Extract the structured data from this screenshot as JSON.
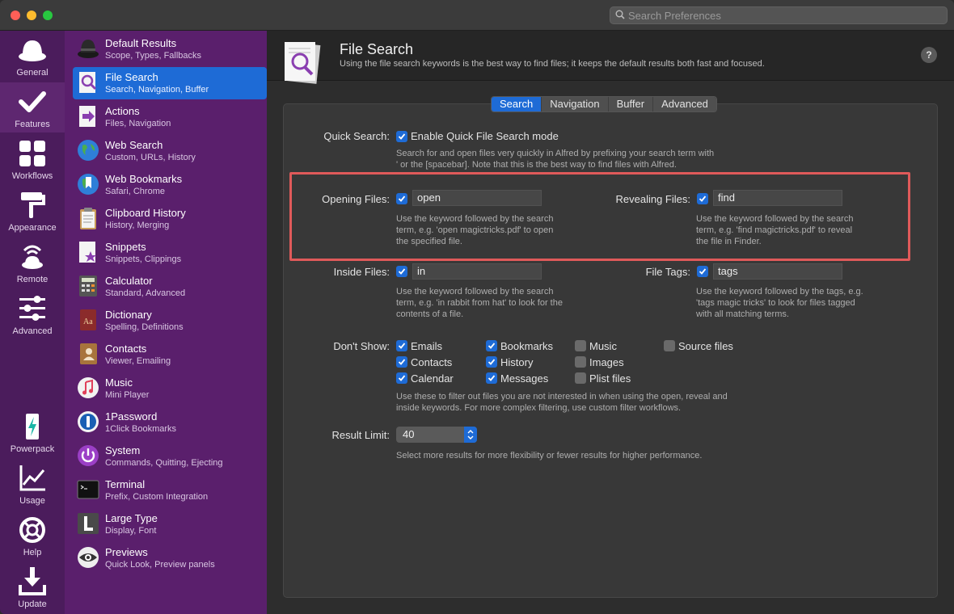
{
  "titlebar": {
    "search_placeholder": "Search Preferences"
  },
  "rail": [
    {
      "label": "General",
      "icon": "hat-icon"
    },
    {
      "label": "Features",
      "icon": "checkmark-icon"
    },
    {
      "label": "Workflows",
      "icon": "grid-icon"
    },
    {
      "label": "Appearance",
      "icon": "paint-roller-icon"
    },
    {
      "label": "Remote",
      "icon": "remote-icon"
    },
    {
      "label": "Advanced",
      "icon": "sliders-icon"
    },
    {
      "label": "Powerpack",
      "icon": "battery-icon"
    },
    {
      "label": "Usage",
      "icon": "chart-icon"
    },
    {
      "label": "Help",
      "icon": "lifebuoy-icon"
    },
    {
      "label": "Update",
      "icon": "download-icon"
    }
  ],
  "features": [
    {
      "title": "Default Results",
      "sub": "Scope, Types, Fallbacks"
    },
    {
      "title": "File Search",
      "sub": "Search, Navigation, Buffer"
    },
    {
      "title": "Actions",
      "sub": "Files, Navigation"
    },
    {
      "title": "Web Search",
      "sub": "Custom, URLs, History"
    },
    {
      "title": "Web Bookmarks",
      "sub": "Safari, Chrome"
    },
    {
      "title": "Clipboard History",
      "sub": "History, Merging"
    },
    {
      "title": "Snippets",
      "sub": "Snippets, Clippings"
    },
    {
      "title": "Calculator",
      "sub": "Standard, Advanced"
    },
    {
      "title": "Dictionary",
      "sub": "Spelling, Definitions"
    },
    {
      "title": "Contacts",
      "sub": "Viewer, Emailing"
    },
    {
      "title": "Music",
      "sub": "Mini Player"
    },
    {
      "title": "1Password",
      "sub": "1Click Bookmarks"
    },
    {
      "title": "System",
      "sub": "Commands, Quitting, Ejecting"
    },
    {
      "title": "Terminal",
      "sub": "Prefix, Custom Integration"
    },
    {
      "title": "Large Type",
      "sub": "Display, Font"
    },
    {
      "title": "Previews",
      "sub": "Quick Look, Preview panels"
    }
  ],
  "header": {
    "title": "File Search",
    "subtitle": "Using the file search keywords is the best way to find files; it keeps the default results both fast and focused.",
    "help": "?"
  },
  "tabs": [
    "Search",
    "Navigation",
    "Buffer",
    "Advanced"
  ],
  "quick_search": {
    "label": "Quick Search:",
    "checkbox": "Enable Quick File Search mode",
    "desc1": "Search for and open files very quickly in Alfred by prefixing your search term with",
    "desc2": "' or the [spacebar]. Note that this is the best way to find files with Alfred."
  },
  "opening": {
    "label": "Opening Files:",
    "value": "open",
    "desc1": "Use the keyword followed by the search",
    "desc2": "term, e.g. 'open magictricks.pdf' to open",
    "desc3": "the specified file."
  },
  "revealing": {
    "label": "Revealing Files:",
    "value": "find",
    "desc1": "Use the keyword followed by the search",
    "desc2": "term, e.g. 'find magictricks.pdf' to reveal",
    "desc3": "the file in Finder."
  },
  "inside": {
    "label": "Inside Files:",
    "value": "in",
    "desc1": "Use the keyword followed by the search",
    "desc2": "term, e.g. 'in rabbit from hat' to look for the",
    "desc3": "contents of a file."
  },
  "tags": {
    "label": "File Tags:",
    "value": "tags",
    "desc1": "Use the keyword followed by the tags, e.g.",
    "desc2": "'tags magic tricks' to look for files tagged",
    "desc3": "with all matching terms."
  },
  "dont_show": {
    "label": "Don't Show:",
    "items": [
      {
        "label": "Emails",
        "checked": true
      },
      {
        "label": "Contacts",
        "checked": true
      },
      {
        "label": "Calendar",
        "checked": true
      },
      {
        "label": "Bookmarks",
        "checked": true
      },
      {
        "label": "History",
        "checked": true
      },
      {
        "label": "Messages",
        "checked": true
      },
      {
        "label": "Music",
        "checked": false
      },
      {
        "label": "Images",
        "checked": false
      },
      {
        "label": "Plist files",
        "checked": false
      },
      {
        "label": "Source files",
        "checked": false
      }
    ],
    "desc1": "Use these to filter out files you are not interested in when using the open, reveal and",
    "desc2": "inside keywords. For more complex filtering, use custom filter workflows."
  },
  "result_limit": {
    "label": "Result Limit:",
    "value": "40",
    "desc": "Select more results for more flexibility or fewer results for higher performance."
  }
}
